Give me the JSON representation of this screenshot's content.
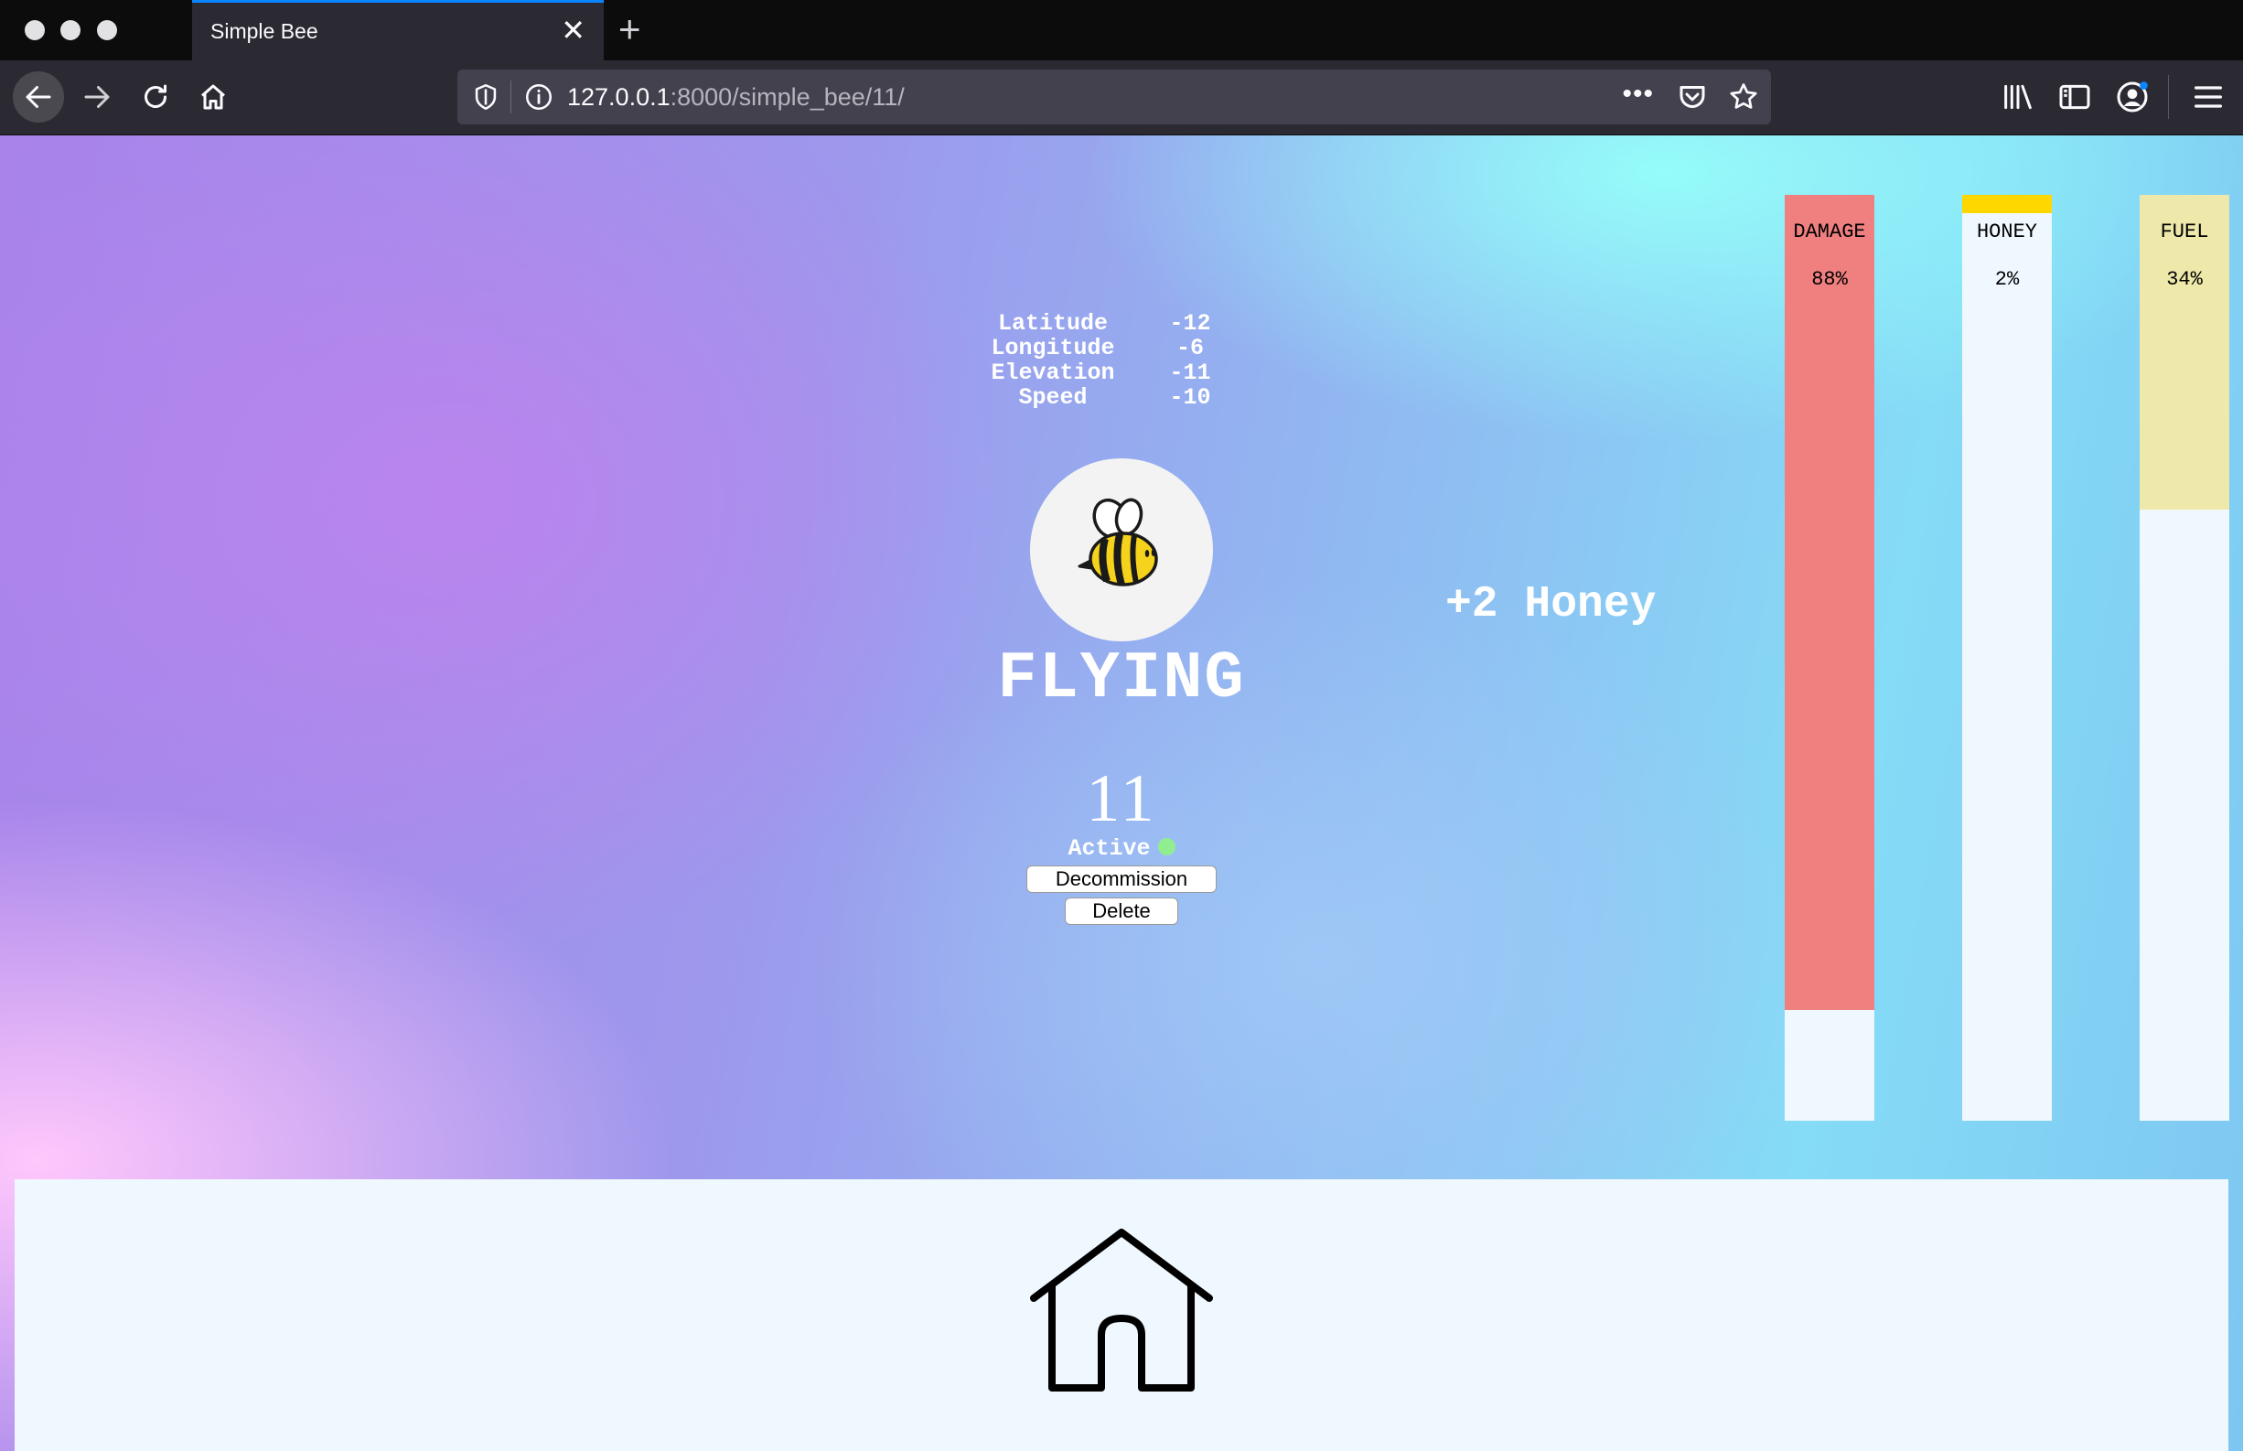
{
  "browser": {
    "tab_title": "Simple Bee",
    "url_host": "127.0.0.1",
    "url_path": ":8000/simple_bee/11/",
    "more_label": "•••"
  },
  "telemetry": [
    {
      "label": "Latitude",
      "value": "-12"
    },
    {
      "label": "Longitude",
      "value": "-6"
    },
    {
      "label": "Elevation",
      "value": "-11"
    },
    {
      "label": "Speed",
      "value": "-10"
    }
  ],
  "bee": {
    "status": "FLYING",
    "id": "11",
    "state": "Active",
    "state_color": "#90ee90"
  },
  "actions": {
    "decommission_label": "Decommission",
    "delete_label": "Delete"
  },
  "event": {
    "honey_gain": "+2 Honey"
  },
  "gauges": [
    {
      "label": "DAMAGE",
      "value_text": "88%",
      "level": 0.88,
      "color": "#f08080"
    },
    {
      "label": "HONEY",
      "value_text": "2%",
      "level": 0.02,
      "color": "#ffd700"
    },
    {
      "label": "FUEL",
      "value_text": "34%",
      "level": 0.34,
      "color": "#eee8aa"
    }
  ],
  "footer": {
    "icon": "home-icon"
  }
}
